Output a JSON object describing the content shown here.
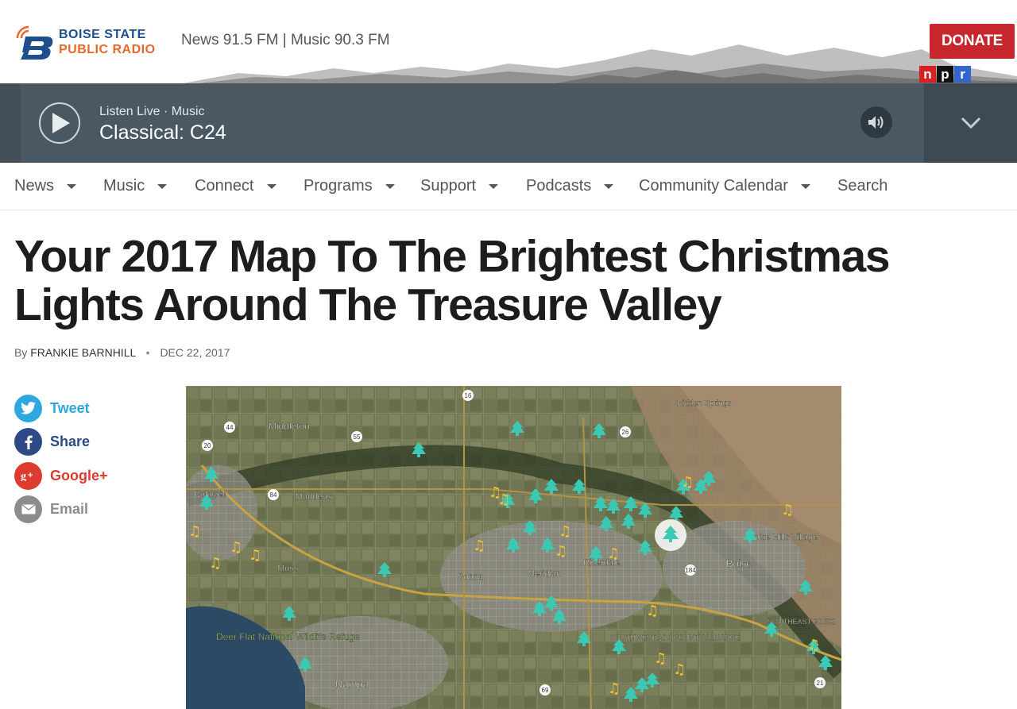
{
  "header": {
    "logo_line1": "BOISE STATE",
    "logo_line2": "PUBLIC RADIO",
    "frequencies": "News 91.5 FM | Music 90.3 FM",
    "donate_label": "DONATE",
    "npr_letters": [
      "n",
      "p",
      "r"
    ]
  },
  "player": {
    "listen_label": "Listen Live · Music",
    "station": "Classical: C24"
  },
  "nav": {
    "items": [
      {
        "label": "News"
      },
      {
        "label": "Music"
      },
      {
        "label": "Connect"
      },
      {
        "label": "Programs"
      },
      {
        "label": "Support"
      },
      {
        "label": "Podcasts"
      },
      {
        "label": "Community Calendar"
      },
      {
        "label": "Search"
      }
    ]
  },
  "article": {
    "headline_line1": "Your 2017 Map To The Brightest Christmas",
    "headline_line2": "Lights Around The Treasure Valley",
    "by": "By",
    "author": "FRANKIE BARNHILL",
    "date": "DEC 22, 2017"
  },
  "social": [
    {
      "label": "Tweet",
      "icon": "twitter-icon",
      "color": "#2ea7e0"
    },
    {
      "label": "Share",
      "icon": "facebook-icon",
      "color": "#2d4a87"
    },
    {
      "label": "Google+",
      "icon": "google-plus-icon",
      "color": "#dc3b2e"
    },
    {
      "label": "Email",
      "icon": "email-icon",
      "color": "#8c8c8c"
    }
  ],
  "map": {
    "places": [
      "Middleton",
      "Caldwell",
      "Maddens",
      "Moss",
      "Sonna",
      "Meridian",
      "Riverdale",
      "Boise",
      "Boise Hills Village",
      "Nampa",
      "Deer Flat National Wildlife Refuge",
      "Hidden Springs",
      "SOUTHEAST BOISE",
      "SOUTHWEST ADA COUNTY ALLIANCE"
    ],
    "routes": [
      "16",
      "44",
      "55",
      "26",
      "84",
      "20",
      "69",
      "184",
      "21"
    ]
  },
  "colors": {
    "donate": "#c8262d",
    "player_bg": "#4a5864",
    "tree_marker": "#3cc9b4",
    "music_marker": "#f2c230"
  }
}
